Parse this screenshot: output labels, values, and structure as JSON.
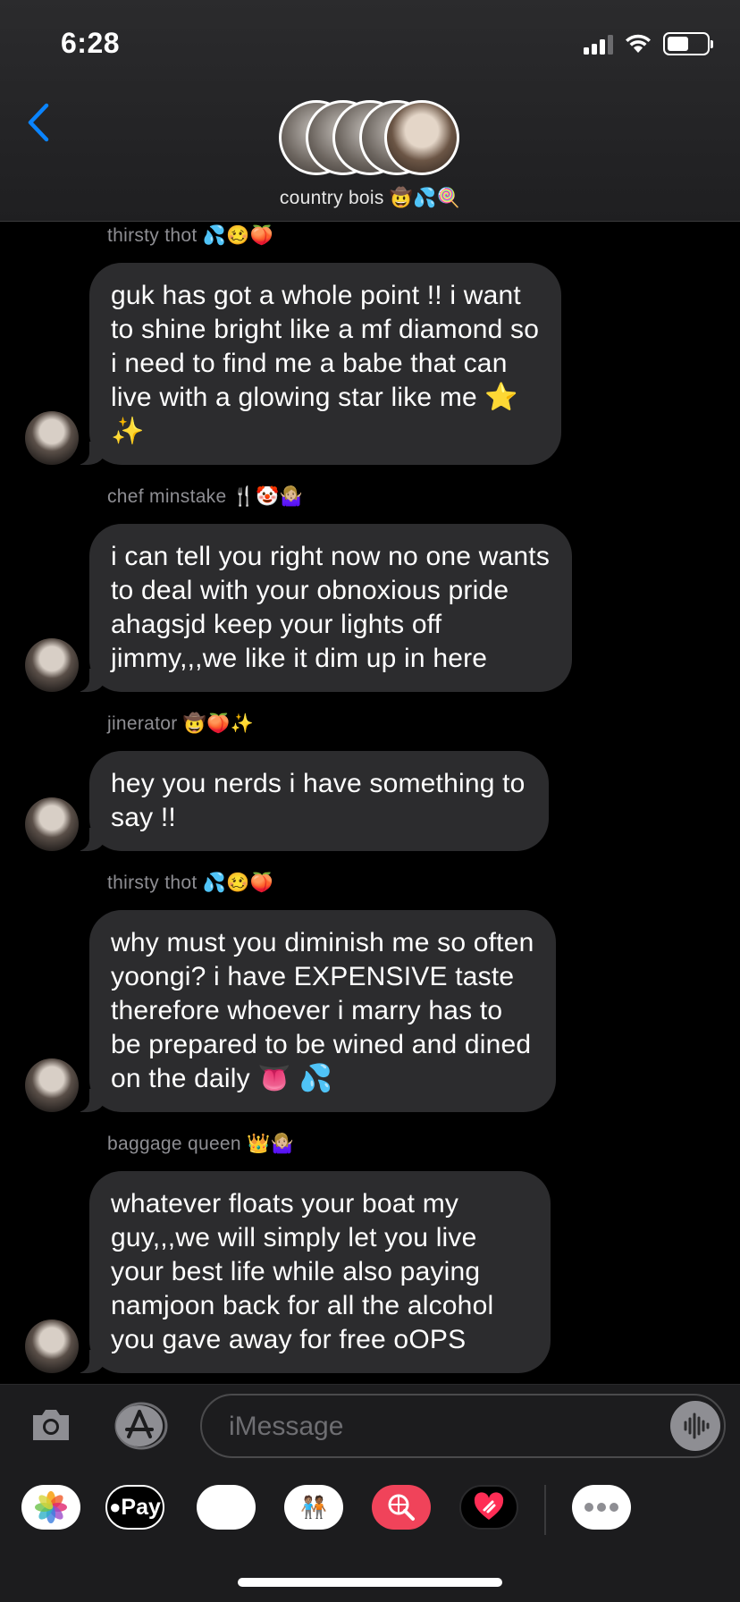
{
  "status": {
    "time": "6:28"
  },
  "header": {
    "group_name": "country bois 🤠💦🍭"
  },
  "messages": [
    {
      "sender": "thirsty thot 💦🥴🍑",
      "text": "guk has got a whole point !! i want to shine bright like a mf diamond so i need to find me a babe that can live with a glowing star like me ⭐️ ✨"
    },
    {
      "sender": "chef minstake 🍴🤡🤷🏼‍♀️",
      "text": "i can tell you right now no one wants to deal with your obnoxious pride ahagsjd keep your lights off jimmy,,,we like it dim up in here"
    },
    {
      "sender": "jinerator 🤠🍑✨",
      "text": "hey you nerds i have something to say !!"
    },
    {
      "sender": "thirsty thot 💦🥴🍑",
      "text": "why must you diminish me so often yoongi? i have EXPENSIVE taste therefore whoever i marry has to be prepared to be wined and dined on the daily 👅 💦"
    },
    {
      "sender": "baggage queen 👑🤷🏼‍♀️",
      "text": "whatever floats your boat my guy,,,we will simply let you live your best life while also paying namjoon back for all the alcohol you gave away for free oOPS"
    }
  ],
  "input": {
    "placeholder": "iMessage"
  },
  "apps": {
    "pay_label": "Pay",
    "memoji": "🐵",
    "memoji2": "🧑🏽‍🤝‍🧑🏾"
  },
  "colors": {
    "accent": "#0a84ff",
    "bubble": "#2c2c2e",
    "background": "#000000"
  }
}
